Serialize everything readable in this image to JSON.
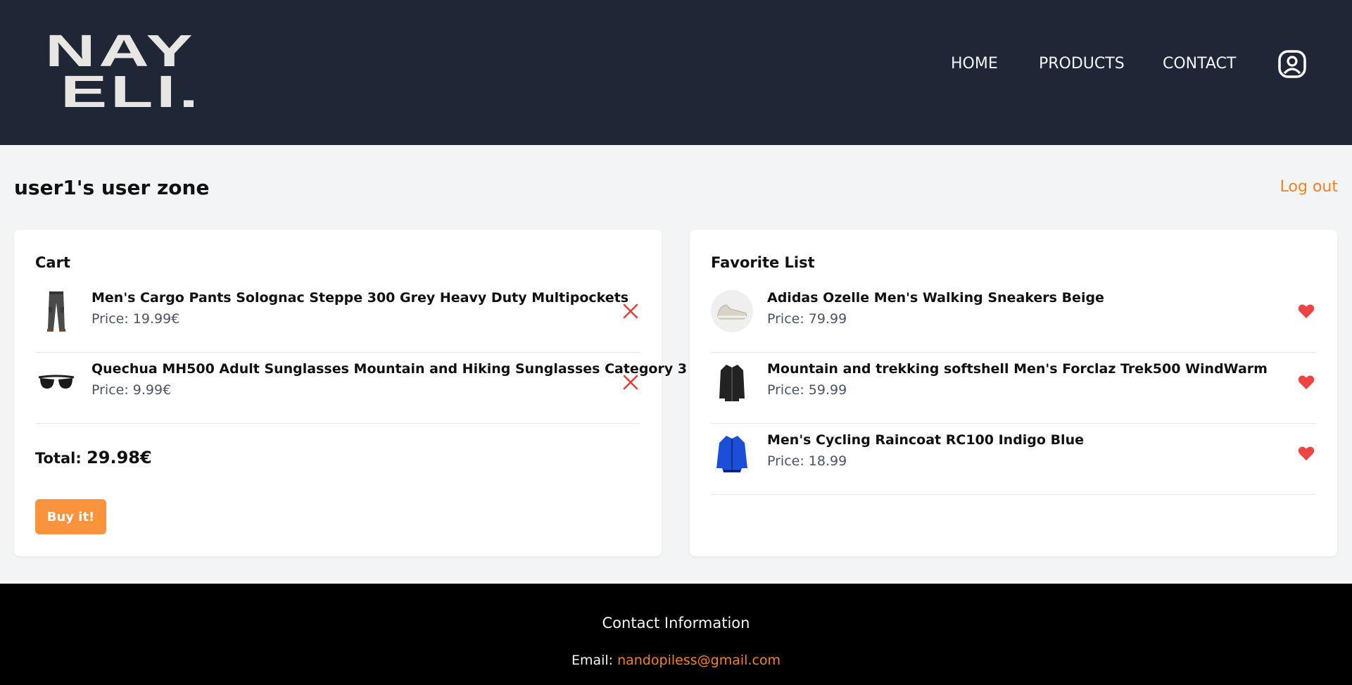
{
  "header": {
    "logo_line1": "NAY",
    "logo_line2": "ELI.",
    "nav": {
      "home": "HOME",
      "products": "PRODUCTS",
      "contact": "CONTACT"
    },
    "user_icon": "user-circle-icon"
  },
  "main": {
    "zone_title": "user1's user zone",
    "logout_label": "Log out",
    "cart": {
      "title": "Cart",
      "items": [
        {
          "name": "Men's Cargo Pants Solognac Steppe 300 Grey Heavy Duty Multipockets",
          "price": "Price: 19.99€",
          "image_icon": "cargo-pants-icon",
          "remove_icon": "close-icon"
        },
        {
          "name": "Quechua MH500 Adult Sunglasses Mountain and Hiking Sunglasses Category 3",
          "price": "Price: 9.99€",
          "image_icon": "sunglasses-icon",
          "remove_icon": "close-icon"
        }
      ],
      "total_label": "Total:",
      "total_value": "29.98€",
      "buy_label": "Buy it!"
    },
    "favorites": {
      "title": "Favorite List",
      "items": [
        {
          "name": "Adidas Ozelle Men's Walking Sneakers Beige",
          "price": "Price: 79.99",
          "image_icon": "sneaker-icon",
          "fav_icon": "heart-icon"
        },
        {
          "name": "Mountain and trekking softshell Men's Forclaz Trek500 WindWarm",
          "price": "Price: 59.99",
          "image_icon": "jacket-icon",
          "fav_icon": "heart-icon"
        },
        {
          "name": "Men's Cycling Raincoat RC100 Indigo Blue",
          "price": "Price: 18.99",
          "image_icon": "raincoat-icon",
          "fav_icon": "heart-icon"
        }
      ]
    }
  },
  "footer": {
    "title": "Contact Information",
    "email_label": "Email:",
    "email_value": "nandopiless@gmail.com"
  },
  "colors": {
    "header_bg": "#1f2737",
    "accent": "#f5821f",
    "button": "#fb923c",
    "remove": "#e53e3e",
    "heart": "#ef4444",
    "footer_bg": "#000000"
  }
}
